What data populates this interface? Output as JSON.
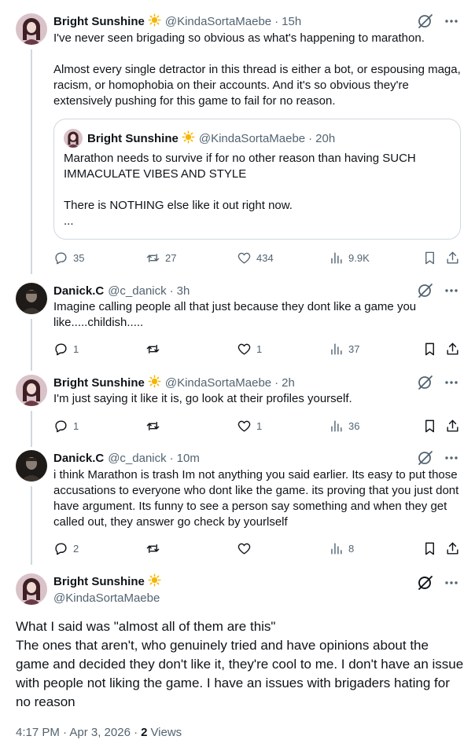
{
  "thread_top": {
    "author_name": "Bright Sunshine",
    "author_emoji": "☀️",
    "handle": "@KindaSortaMaebe",
    "dot": "·",
    "time": "15h",
    "text_lines": [
      "I've never seen brigading so obvious as what's happening to marathon.",
      "Almost every single detractor in this thread is either a bot, or espousing maga, racism, or homophobia on their accounts. And it's so obvious they're extensively pushing for this game to fail for no reason."
    ],
    "quote": {
      "author_name": "Bright Sunshine",
      "author_emoji": "☀️",
      "handle": "@KindaSortaMaebe",
      "dot": "·",
      "time": "20h",
      "text_lines": [
        "Marathon needs to survive if for no other reason than having SUCH IMMACULATE VIBES AND STYLE",
        "There is NOTHING else like it out right now.",
        "..."
      ]
    },
    "stats": {
      "replies": "35",
      "reposts": "27",
      "likes": "434",
      "views": "9.9K"
    }
  },
  "reply_1": {
    "author_name": "Danick.C",
    "handle": "@c_danick",
    "dot": "·",
    "time": "3h",
    "text": "Imagine calling people all that just because they dont like a game you like.....childish.....",
    "stats": {
      "replies": "1",
      "reposts": "",
      "likes": "1",
      "views": "37"
    }
  },
  "reply_2": {
    "author_name": "Bright Sunshine",
    "author_emoji": "☀️",
    "handle": "@KindaSortaMaebe",
    "dot": "·",
    "time": "2h",
    "text": "I'm just saying it like it is, go look at their profiles yourself.",
    "stats": {
      "replies": "1",
      "reposts": "",
      "likes": "1",
      "views": "36"
    }
  },
  "reply_3": {
    "author_name": "Danick.C",
    "handle": "@c_danick",
    "dot": "·",
    "time": "10m",
    "text": "i think Marathon is trash Im not anything you said earlier. Its easy to put those accusations to everyone who dont like the game. its proving that you just dont have argument. Its funny to see a person say something and when they get called out, they answer go check by yourlself",
    "stats": {
      "replies": "2",
      "reposts": "",
      "likes": "",
      "views": "8"
    }
  },
  "main_tweet": {
    "author_name": "Bright Sunshine",
    "author_emoji": "☀️",
    "handle": "@KindaSortaMaebe",
    "text_lines": [
      "What I said was \"almost all of them are this\"",
      "The ones that aren't, who genuinely tried and have opinions about the game and decided they don't like it, they're cool to me. I don't have an issue with people not liking the game. I have an issues with brigaders hating for no reason"
    ],
    "timestamp": "4:17 PM · Apr 3, 2026 ·",
    "views_count": "2",
    "views_label": "Views"
  },
  "colors": {
    "text_primary": "#0f1419",
    "text_secondary": "#536471",
    "border": "#cfd9de",
    "sun": "#f7b500"
  },
  "icons": [
    "reply-icon",
    "repost-icon",
    "like-icon",
    "views-icon",
    "bookmark-icon",
    "share-icon",
    "grok-icon",
    "more-icon"
  ]
}
